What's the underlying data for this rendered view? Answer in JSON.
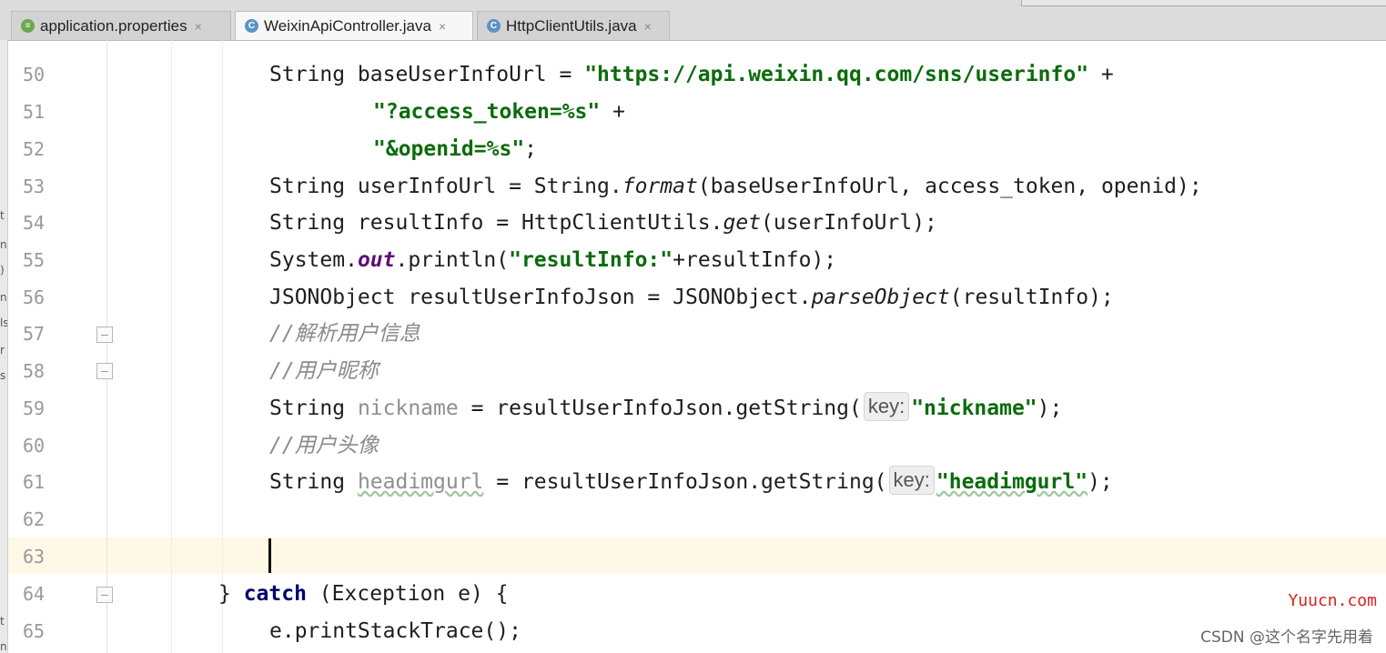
{
  "tabs": [
    {
      "label": "application.properties",
      "icon": "properties-file-icon"
    },
    {
      "label": "WeixinApiController.java",
      "icon": "java-class-icon"
    },
    {
      "label": "HttpClientUtils.java",
      "icon": "java-class-icon"
    }
  ],
  "editor": {
    "line_numbers": [
      "50",
      "51",
      "52",
      "53",
      "54",
      "55",
      "56",
      "57",
      "58",
      "59",
      "60",
      "61",
      "62",
      "63",
      "64",
      "65"
    ],
    "current_line": "63",
    "lines": {
      "l50": {
        "a": "String baseUserInfoUrl = ",
        "s": "\"https://api.weixin.qq.com/sns/userinfo\"",
        "b": " +"
      },
      "l51": {
        "s": "\"?access_token=%s\"",
        "b": " +"
      },
      "l52": {
        "s": "\"&openid=%s\"",
        "b": ";"
      },
      "l53": {
        "a": "String userInfoUrl = String.",
        "m": "format",
        "b": "(baseUserInfoUrl, access_token, openid);"
      },
      "l54": {
        "a": "String resultInfo = HttpClientUtils.",
        "m": "get",
        "b": "(userInfoUrl);"
      },
      "l55": {
        "a": "System.",
        "f": "out",
        "b": ".println(",
        "s": "\"resultInfo:\"",
        "c": "+resultInfo);"
      },
      "l56": {
        "a": "JSONObject resultUserInfoJson = JSONObject.",
        "m": "parseObject",
        "b": "(resultInfo);"
      },
      "l57": {
        "cmt": "//解析用户信息"
      },
      "l58": {
        "cmt": "//用户昵称"
      },
      "l59": {
        "a": "String ",
        "v": "nickname",
        "b": " = resultUserInfoJson.getString(",
        "hint": "key:",
        "s": "\"nickname\"",
        "c": ");"
      },
      "l60": {
        "cmt": "//用户头像"
      },
      "l61": {
        "a": "String ",
        "v": "headimgurl",
        "b": " = resultUserInfoJson.getString(",
        "hint": "key:",
        "s": "\"headimgurl\"",
        "c": ");"
      },
      "l64": {
        "a": "} ",
        "kw": "catch",
        "b": " (Exception e) {"
      },
      "l65": {
        "a": "e.printStackTrace();"
      }
    }
  },
  "watermarks": {
    "site": "Yuucn.com",
    "csdn": "CSDN @这个名字先用着"
  }
}
